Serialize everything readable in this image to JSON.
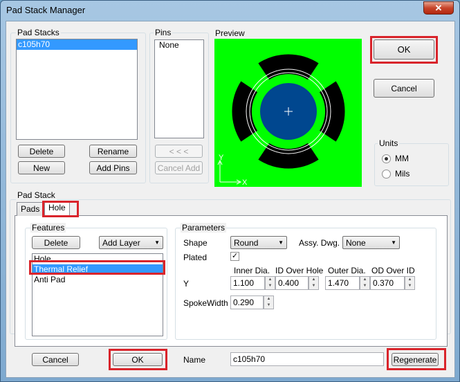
{
  "window": {
    "title": "Pad Stack Manager",
    "close_glyph": "✕"
  },
  "pad_stacks": {
    "label": "Pad Stacks",
    "items": [
      "c105h70"
    ],
    "buttons": {
      "delete": "Delete",
      "rename": "Rename",
      "new": "New",
      "add_pins": "Add Pins"
    }
  },
  "pins": {
    "label": "Pins",
    "items": [
      "None"
    ],
    "buttons": {
      "move_left": "< < <",
      "cancel_add": "Cancel Add"
    }
  },
  "preview": {
    "label": "Preview",
    "axis_x": "X",
    "axis_y": "Y",
    "colors": {
      "background": "#00ff00",
      "relief": "#000000",
      "pad": "#00478f",
      "ring": "#ffffff"
    }
  },
  "actions": {
    "ok": "OK",
    "cancel": "Cancel"
  },
  "units": {
    "label": "Units",
    "options": [
      "MM",
      "Mils"
    ],
    "selected": "MM"
  },
  "pad_stack": {
    "label": "Pad Stack",
    "tabs": [
      "Pads",
      "Hole"
    ],
    "active_tab": "Hole",
    "features": {
      "label": "Features",
      "delete": "Delete",
      "add_layer": "Add Layer",
      "items": [
        "Hole",
        "Thermal Relief",
        "Anti Pad"
      ],
      "selected": "Thermal Relief"
    },
    "parameters": {
      "label": "Parameters",
      "shape_label": "Shape",
      "shape_value": "Round",
      "assy_label": "Assy. Dwg.",
      "assy_value": "None",
      "plated_label": "Plated",
      "plated": true,
      "col_inner": "Inner Dia.",
      "col_id_over_hole": "ID Over Hole",
      "col_outer": "Outer Dia.",
      "col_od_over_id": "OD Over ID",
      "row_label": "Y",
      "inner": "1.100",
      "id_over_hole": "0.400",
      "outer": "1.470",
      "od_over_id": "0.370",
      "spoke_label": "SpokeWidth",
      "spoke": "0.290"
    }
  },
  "footer": {
    "cancel": "Cancel",
    "ok": "OK",
    "name_label": "Name",
    "name_value": "c105h70",
    "regenerate": "Regenerate"
  }
}
